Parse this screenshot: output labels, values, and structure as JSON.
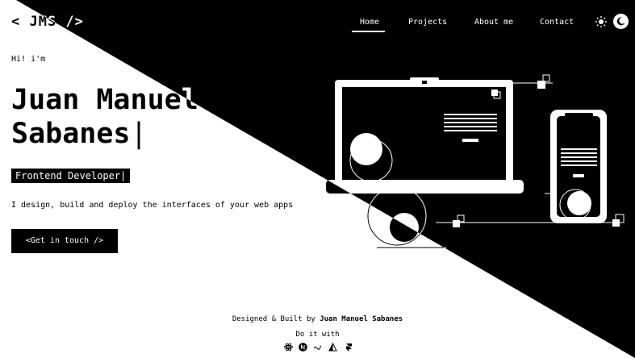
{
  "logo": {
    "text": "< JMS />"
  },
  "nav": {
    "items": [
      {
        "label": "Home",
        "active": true
      },
      {
        "label": "Projects"
      },
      {
        "label": "About me"
      },
      {
        "label": "Contact"
      }
    ]
  },
  "theme": {
    "light_icon": "sun-icon",
    "dark_icon": "moon-icon"
  },
  "hero": {
    "greeting": "Hi! i'm",
    "name_line1": "Juan Manuel",
    "name_line2": "Sabanes",
    "cursor": "|",
    "role": "Frontend Developer|",
    "tagline": "I design, build and deploy the interfaces of your web apps",
    "cta_label": "<Get in touch />"
  },
  "illustration": {
    "name": "laptop-and-phone-illustration"
  },
  "footer": {
    "credit_prefix": "Designed & Built by ",
    "credit_name": "Juan Manuel Sabanes",
    "tools_label": "Do it with",
    "tool_icons": [
      "react-icon",
      "nextjs-icon",
      "styled-components-icon",
      "vercel-icon",
      "framer-icon"
    ]
  },
  "colors": {
    "background_light": "#ffffff",
    "background_dark": "#000000"
  }
}
